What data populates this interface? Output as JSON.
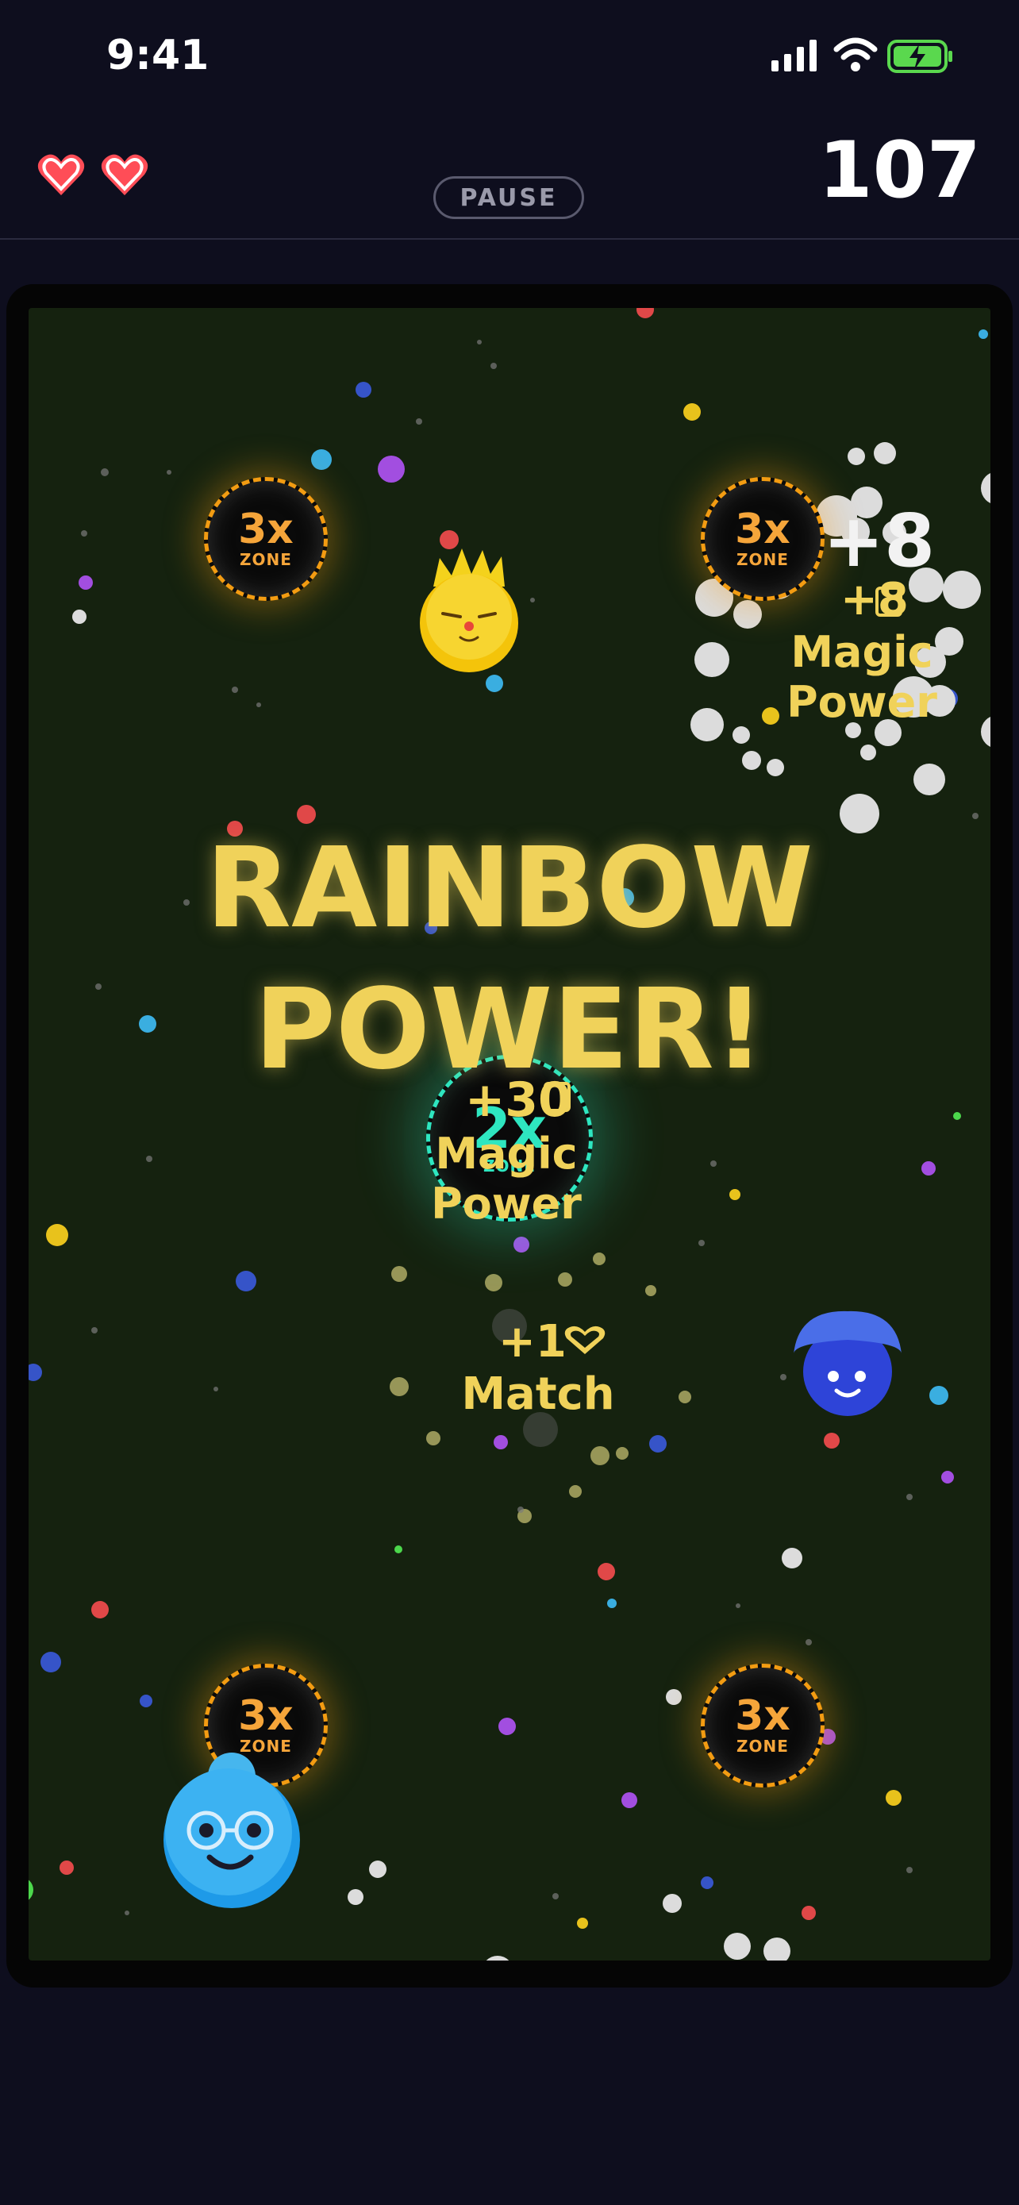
{
  "status_bar": {
    "time": "9:41"
  },
  "hud": {
    "lives": 2,
    "pause_label": "PAUSE",
    "score": "107"
  },
  "game": {
    "zones": [
      {
        "multiplier": "3x",
        "label": "ZONE"
      },
      {
        "multiplier": "3x",
        "label": "ZONE"
      },
      {
        "multiplier": "2x",
        "label": "ZONE"
      },
      {
        "multiplier": "3x",
        "label": "ZONE"
      },
      {
        "multiplier": "3x",
        "label": "ZONE"
      }
    ],
    "banner_line1": "RAINBOW",
    "banner_line2": "POWER!",
    "popups": {
      "top_right_big": "+8",
      "top_right_small": "+8",
      "top_right_label": "Magic Power",
      "center_points": "+30",
      "center_label": "Magic Power",
      "match_points": "+1",
      "match_label": "Match"
    },
    "characters": [
      "yellow-crown-blob",
      "blue-hat-blob",
      "light-blue-glasses-blob"
    ]
  },
  "colors": {
    "accent_gold": "#f0d25a",
    "zone_orange": "#f39c12",
    "zone_teal": "#2ee6c0",
    "heart_red": "#ff4d57",
    "arena_green": "#15220f"
  }
}
